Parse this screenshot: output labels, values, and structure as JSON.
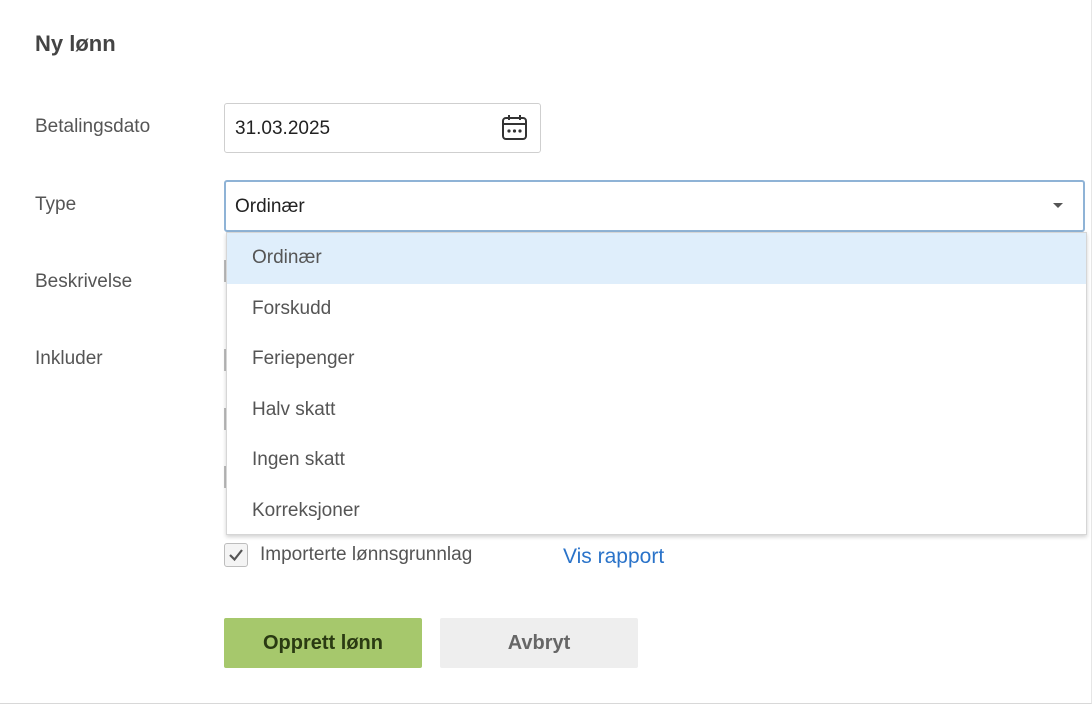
{
  "dialog": {
    "title": "Ny lønn"
  },
  "form": {
    "payment_date_label": "Betalingsdato",
    "payment_date_value": "31.03.2025",
    "type_label": "Type",
    "type_value": "Ordinær",
    "description_label": "Beskrivelse",
    "include_label": "Inkluder"
  },
  "type_options": [
    "Ordinær",
    "Forskudd",
    "Feriepenger",
    "Halv skatt",
    "Ingen skatt",
    "Korreksjoner"
  ],
  "selected_option_index": 0,
  "include": {
    "imported_label": "Importerte lønnsgrunnlag",
    "imported_checked": true,
    "report_link": "Vis rapport"
  },
  "buttons": {
    "create": "Opprett lønn",
    "cancel": "Avbryt"
  },
  "colors": {
    "primary_button": "#a6c86c",
    "link": "#2a73c9",
    "selected_option_bg": "#dfeefb",
    "focus_border": "#8fb3d6"
  },
  "icons": {
    "date": "calendar-icon",
    "select": "caret-down-icon",
    "check": "checkmark-icon"
  }
}
